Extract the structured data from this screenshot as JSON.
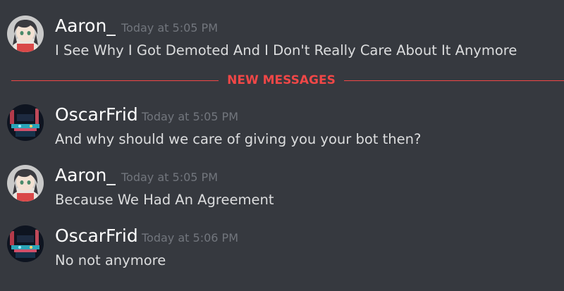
{
  "colors": {
    "background": "#36393f",
    "username": "#ffffff",
    "timestamp": "#72767d",
    "message_text": "#dcddde",
    "new_messages_accent": "#f04747"
  },
  "divider": {
    "label": "NEW MESSAGES"
  },
  "messages": [
    {
      "username": "Aaron_",
      "timestamp": "Today at 5:05 PM",
      "content": "I See Why I Got Demoted And I Don't Really Care About It Anymore",
      "avatar_icon": "anime-girl-avatar"
    },
    {
      "username": "OscarFrid",
      "timestamp": "Today at 5:05 PM",
      "content": "And why should we care of giving you your bot then?",
      "avatar_icon": "neon-city-avatar"
    },
    {
      "username": "Aaron_",
      "timestamp": "Today at 5:05 PM",
      "content": "Because We Had An Agreement",
      "avatar_icon": "anime-girl-avatar"
    },
    {
      "username": "OscarFrid",
      "timestamp": "Today at 5:06 PM",
      "content": "No not anymore",
      "avatar_icon": "neon-city-avatar"
    }
  ]
}
